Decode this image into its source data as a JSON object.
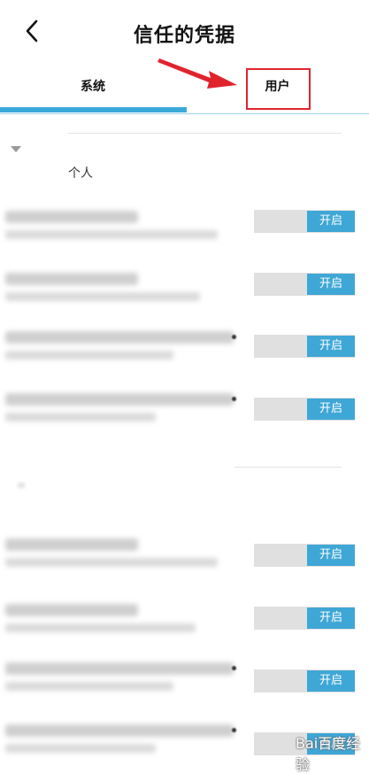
{
  "header": {
    "title": "信任的凭据",
    "back_icon": "chevron-left-icon"
  },
  "tabs": [
    {
      "label": "系统",
      "selected": true
    },
    {
      "label": "用户",
      "selected": false
    }
  ],
  "colors": {
    "accent": "#3aa9d9",
    "toggle_button": "#3fa7d6",
    "annotation": "#e0242e"
  },
  "section_personal": {
    "label": "个人"
  },
  "toggle_label": "开启",
  "certificates_group1": [
    {
      "toggle": "开启"
    },
    {
      "toggle": "开启"
    },
    {
      "toggle": "开启"
    },
    {
      "toggle": "开启"
    }
  ],
  "certificates_group2": [
    {
      "toggle": "开启"
    },
    {
      "toggle": "开启"
    },
    {
      "toggle": "开启"
    },
    {
      "toggle": "开启"
    }
  ],
  "watermark": {
    "text": "Bai百度经验"
  }
}
